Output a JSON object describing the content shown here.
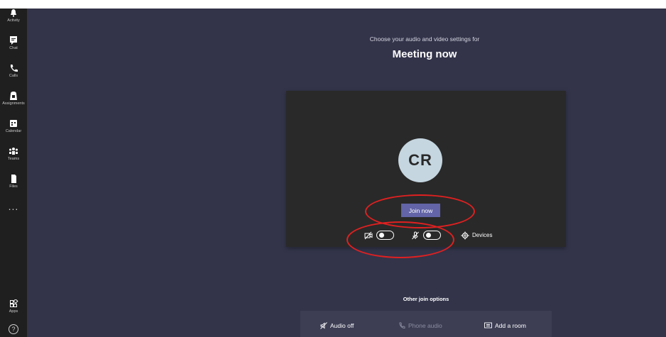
{
  "rail": {
    "items": [
      {
        "label": "Activity",
        "icon": "bell-icon"
      },
      {
        "label": "Chat",
        "icon": "chat-icon"
      },
      {
        "label": "Calls",
        "icon": "phone-icon"
      },
      {
        "label": "Assignments",
        "icon": "assignments-icon"
      },
      {
        "label": "Calendar",
        "icon": "calendar-icon"
      },
      {
        "label": "Teams",
        "icon": "teams-icon"
      },
      {
        "label": "Files",
        "icon": "files-icon"
      }
    ],
    "more": "...",
    "apps_label": "Apps",
    "help": "?"
  },
  "prejoin": {
    "subtitle": "Choose your audio and video settings for",
    "title": "Meeting now",
    "avatar_initials": "CR",
    "join_label": "Join now",
    "devices_label": "Devices",
    "camera_on": false,
    "mic_on": false
  },
  "other": {
    "heading": "Other join options",
    "options": [
      {
        "label": "Audio off",
        "icon": "audio-off-icon"
      },
      {
        "label": "Phone audio",
        "icon": "phone-audio-icon",
        "disabled": true
      },
      {
        "label": "Add a room",
        "icon": "room-icon"
      }
    ]
  },
  "colors": {
    "background": "#33344a",
    "rail": "#1f1f1f",
    "panel": "#292929",
    "accent": "#6264a7",
    "annotation": "#e02020"
  }
}
